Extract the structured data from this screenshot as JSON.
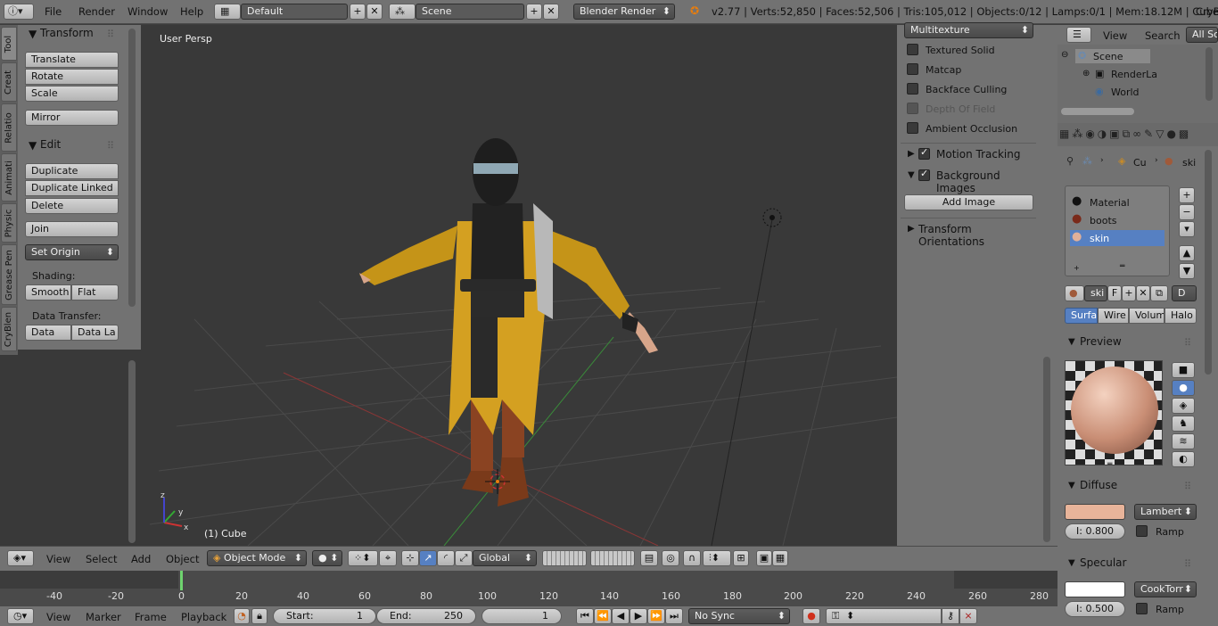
{
  "topbar": {
    "menus": [
      "File",
      "Render",
      "Window",
      "Help"
    ],
    "layout": "Default",
    "scene": "Scene",
    "engine": "Blender Render",
    "stats": "v2.77 | Verts:52,850 | Faces:52,506 | Tris:105,012 | Objects:0/12 | Lamps:0/1 | Mem:18.12M | Cube",
    "right_label": "CryBl"
  },
  "left_tabs": [
    "Tool",
    "Creat",
    "Relatio",
    "Animati",
    "Physic",
    "Grease Pen",
    "CryBlen"
  ],
  "toolpanel": {
    "transform_title": "Transform",
    "translate": "Translate",
    "rotate": "Rotate",
    "scale": "Scale",
    "mirror": "Mirror",
    "edit_title": "Edit",
    "duplicate": "Duplicate",
    "duplicate_linked": "Duplicate Linked",
    "delete": "Delete",
    "join": "Join",
    "set_origin": "Set Origin",
    "shading_label": "Shading:",
    "smooth": "Smooth",
    "flat": "Flat",
    "data_transfer_label": "Data Transfer:",
    "data": "Data",
    "data_la": "Data La"
  },
  "viewport": {
    "view_name": "User Persp",
    "object_label": "(1) Cube"
  },
  "npanel": {
    "shading_mode": "Multitexture",
    "textured_solid": "Textured Solid",
    "matcap": "Matcap",
    "backface_culling": "Backface Culling",
    "depth_of_field": "Depth Of Field",
    "ambient_occlusion": "Ambient Occlusion",
    "motion_tracking": "Motion Tracking",
    "background_images": "Background Images",
    "add_image": "Add Image",
    "transform_orientations": "Transform Orientations"
  },
  "outliner": {
    "view": "View",
    "search": "Search",
    "all_scenes": "All Sc",
    "scene": "Scene",
    "render_layers": "RenderLa",
    "world": "World"
  },
  "props": {
    "breadcrumb_cube": "Cu",
    "breadcrumb_skin": "ski",
    "materials": [
      "Material",
      "boots",
      "skin"
    ],
    "selected_material": 2,
    "mat_name": "ski",
    "f_label": "F",
    "d_label": "D",
    "tabs": [
      "Surfac",
      "Wire",
      "Volum",
      "Halo"
    ],
    "preview_title": "Preview",
    "diffuse_title": "Diffuse",
    "diffuse_shader": "Lambert",
    "diffuse_intensity": "I: 0.800",
    "ramp": "Ramp",
    "specular_title": "Specular",
    "specular_shader": "CookTorr",
    "specular_intensity": "I: 0.500",
    "colors": {
      "diffuse": "#e8b49a",
      "specular": "#ffffff",
      "accent": "#5680c2"
    }
  },
  "vheader": {
    "menus": [
      "View",
      "Select",
      "Add",
      "Object"
    ],
    "mode": "Object Mode",
    "orientation": "Global"
  },
  "timeline": {
    "ticks": [
      "-40",
      "-20",
      "0",
      "20",
      "40",
      "60",
      "80",
      "100",
      "120",
      "140",
      "160",
      "180",
      "200",
      "220",
      "240",
      "260",
      "280"
    ]
  },
  "theader": {
    "menus": [
      "View",
      "Marker",
      "Frame",
      "Playback"
    ],
    "start_label": "Start:",
    "start_value": "1",
    "end_label": "End:",
    "end_value": "250",
    "current_frame": "1",
    "sync": "No Sync"
  }
}
